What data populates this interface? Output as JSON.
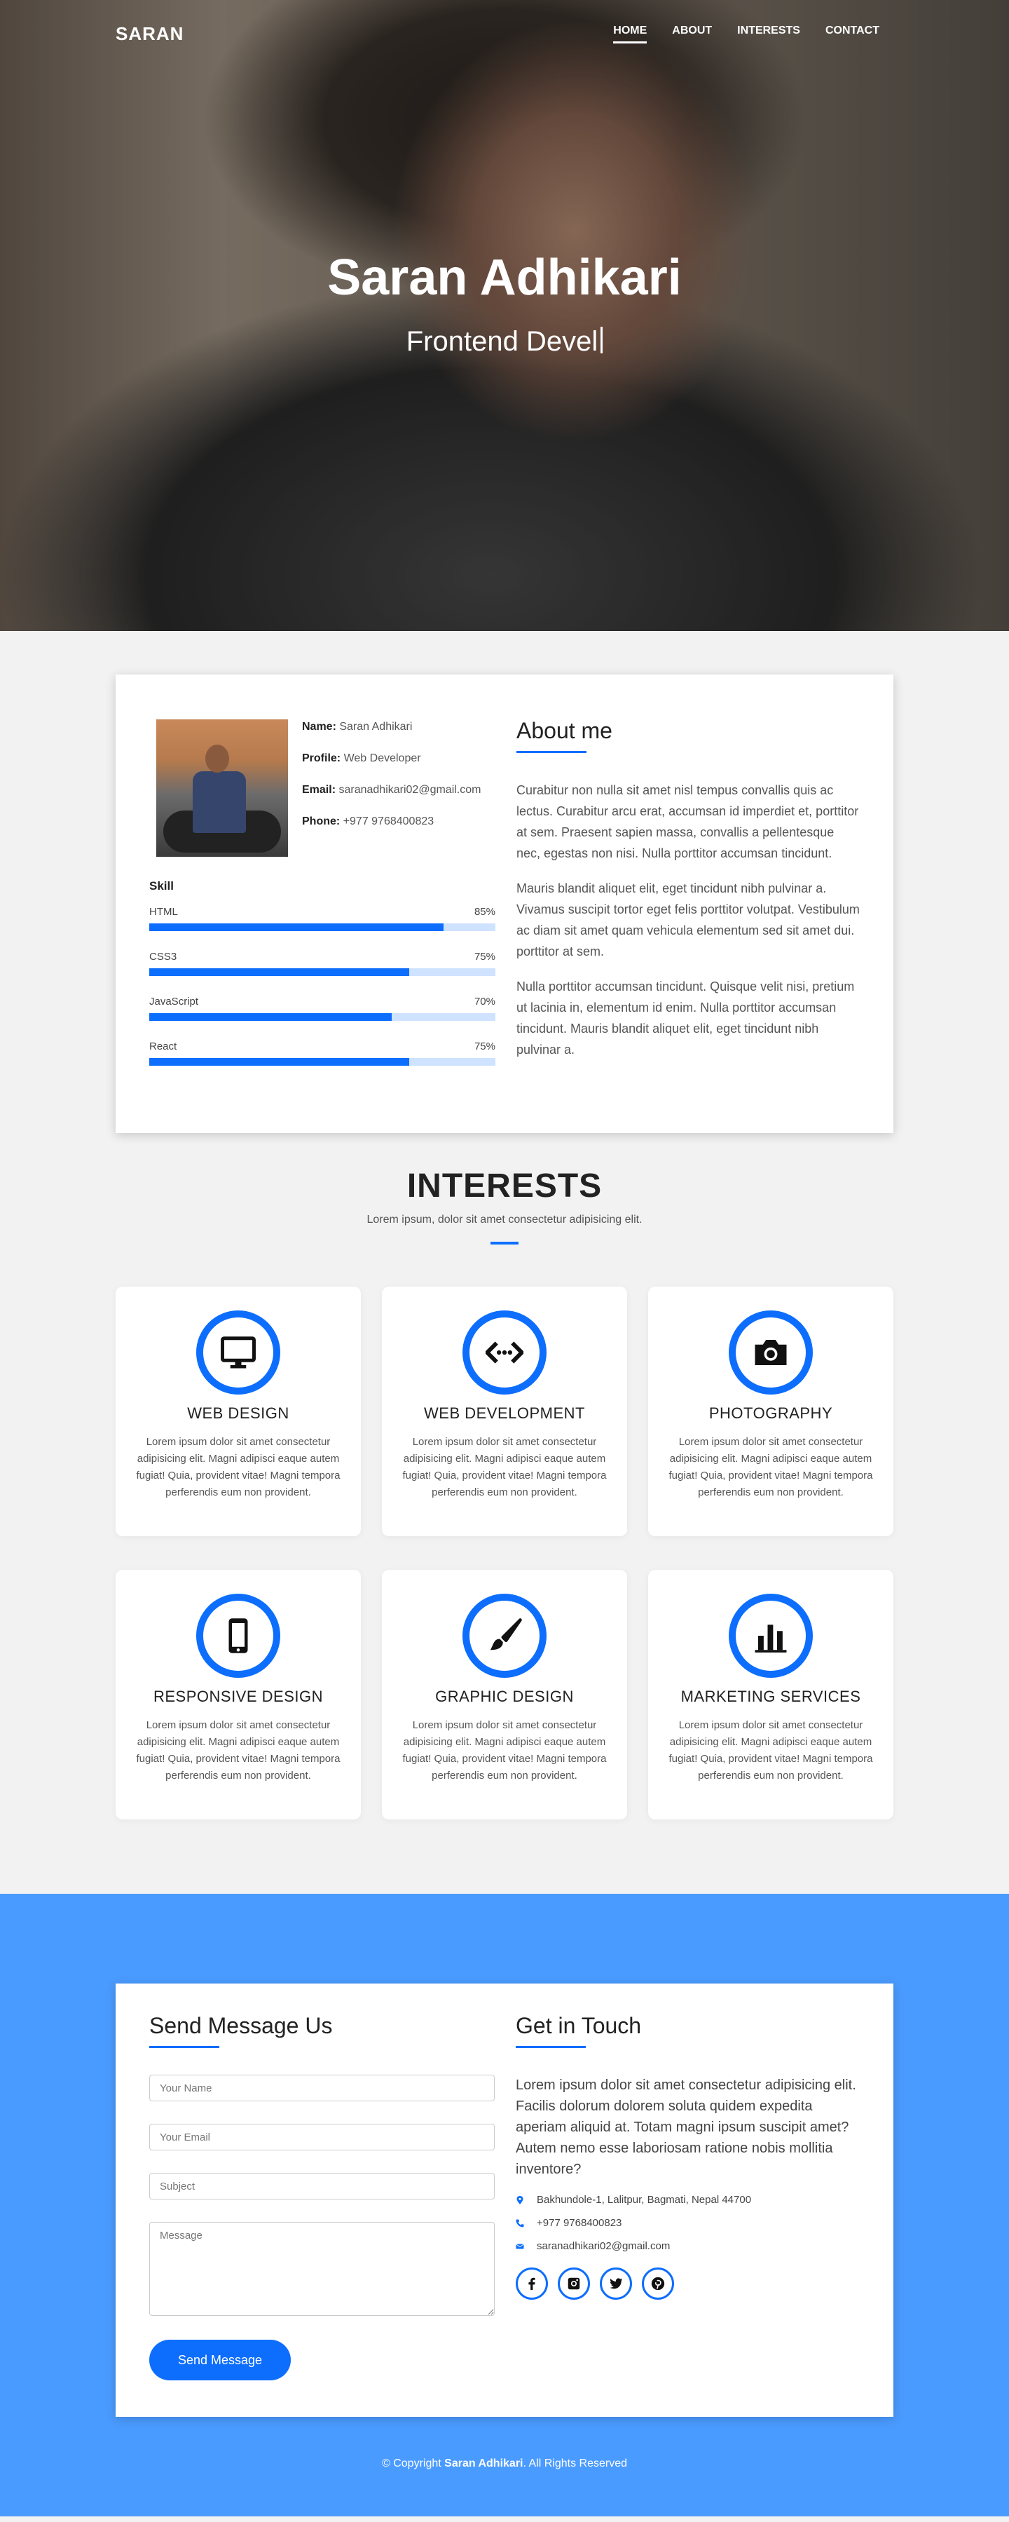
{
  "nav": {
    "brand": "SARAN",
    "links": [
      "HOME",
      "ABOUT",
      "INTERESTS",
      "CONTACT"
    ]
  },
  "hero": {
    "name": "Saran Adhikari",
    "role": "Frontend Devel"
  },
  "about": {
    "profile": {
      "name_label": "Name:",
      "name": "Saran Adhikari",
      "profile_label": "Profile:",
      "profile": "Web Developer",
      "email_label": "Email:",
      "email": "saranadhikari02@gmail.com",
      "phone_label": "Phone:",
      "phone": "+977 9768400823"
    },
    "skill_title": "Skill",
    "skills": [
      {
        "name": "HTML",
        "percent": "85%",
        "value": 85
      },
      {
        "name": "CSS3",
        "percent": "75%",
        "value": 75
      },
      {
        "name": "JavaScript",
        "percent": "70%",
        "value": 70
      },
      {
        "name": "React",
        "percent": "75%",
        "value": 75
      }
    ],
    "title": "About me",
    "paragraphs": [
      "Curabitur non nulla sit amet nisl tempus convallis quis ac lectus. Curabitur arcu erat, accumsan id imperdiet et, porttitor at sem. Praesent sapien massa, convallis a pellentesque nec, egestas non nisi. Nulla porttitor accumsan tincidunt.",
      "Mauris blandit aliquet elit, eget tincidunt nibh pulvinar a. Vivamus suscipit tortor eget felis porttitor volutpat. Vestibulum ac diam sit amet quam vehicula elementum sed sit amet dui. porttitor at sem.",
      "Nulla porttitor accumsan tincidunt. Quisque velit nisi, pretium ut lacinia in, elementum id enim. Nulla porttitor accumsan tincidunt. Mauris blandit aliquet elit, eget tincidunt nibh pulvinar a."
    ]
  },
  "interests": {
    "title": "INTERESTS",
    "subtitle": "Lorem ipsum, dolor sit amet consectetur adipisicing elit.",
    "items": [
      {
        "icon": "monitor-icon",
        "title": "WEB DESIGN",
        "text": "Lorem ipsum dolor sit amet consectetur adipisicing elit. Magni adipisci eaque autem fugiat! Quia, provident vitae! Magni tempora perferendis eum non provident."
      },
      {
        "icon": "code-icon",
        "title": "WEB DEVELOPMENT",
        "text": "Lorem ipsum dolor sit amet consectetur adipisicing elit. Magni adipisci eaque autem fugiat! Quia, provident vitae! Magni tempora perferendis eum non provident."
      },
      {
        "icon": "camera-icon",
        "title": "PHOTOGRAPHY",
        "text": "Lorem ipsum dolor sit amet consectetur adipisicing elit. Magni adipisci eaque autem fugiat! Quia, provident vitae! Magni tempora perferendis eum non provident."
      },
      {
        "icon": "mobile-icon",
        "title": "RESPONSIVE DESIGN",
        "text": "Lorem ipsum dolor sit amet consectetur adipisicing elit. Magni adipisci eaque autem fugiat! Quia, provident vitae! Magni tempora perferendis eum non provident."
      },
      {
        "icon": "paintbrush-icon",
        "title": "GRAPHIC DESIGN",
        "text": "Lorem ipsum dolor sit amet consectetur adipisicing elit. Magni adipisci eaque autem fugiat! Quia, provident vitae! Magni tempora perferendis eum non provident."
      },
      {
        "icon": "bar-chart-icon",
        "title": "MARKETING SERVICES",
        "text": "Lorem ipsum dolor sit amet consectetur adipisicing elit. Magni adipisci eaque autem fugiat! Quia, provident vitae! Magni tempora perferendis eum non provident."
      }
    ]
  },
  "contact": {
    "form_title": "Send Message Us",
    "placeholders": {
      "name": "Your Name",
      "email": "Your Email",
      "subject": "Subject",
      "message": "Message"
    },
    "send_label": "Send Message",
    "touch_title": "Get in Touch",
    "touch_text": "Lorem ipsum dolor sit amet consectetur adipisicing elit. Facilis dolorum dolorem soluta quidem expedita aperiam aliquid at. Totam magni ipsum suscipit amet? Autem nemo esse laboriosam ratione nobis mollitia inventore?",
    "address": "Bakhundole-1, Lalitpur, Bagmati, Nepal 44700",
    "phone": "+977 9768400823",
    "email": "saranadhikari02@gmail.com",
    "socials": [
      "facebook-icon",
      "instagram-icon",
      "twitter-icon",
      "pinterest-icon"
    ]
  },
  "footer": {
    "prefix": "© Copyright",
    "name": "Saran Adhikari",
    "suffix": ". All Rights Reserved"
  },
  "colors": {
    "accent": "#0d6efd",
    "contact_bg": "#4a9bff"
  }
}
